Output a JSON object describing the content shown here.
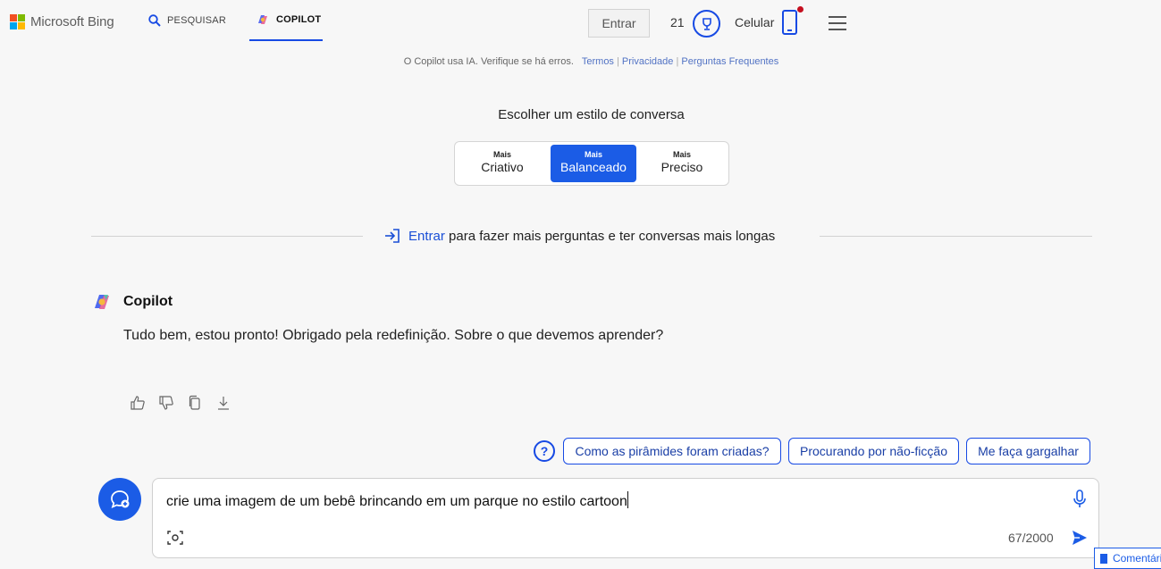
{
  "header": {
    "logo_text": "Microsoft Bing",
    "nav_search": "PESQUISAR",
    "nav_copilot": "COPILOT",
    "signin_button": "Entrar",
    "points": "21",
    "mobile_label": "Celular"
  },
  "disclaimer": {
    "text": "O Copilot usa IA. Verifique se há erros.",
    "terms": "Termos",
    "privacy": "Privacidade",
    "faq": "Perguntas Frequentes"
  },
  "style_picker": {
    "title": "Escolher um estilo de conversa",
    "options": [
      {
        "prefix": "Mais",
        "label": "Criativo"
      },
      {
        "prefix": "Mais",
        "label": "Balanceado"
      },
      {
        "prefix": "Mais",
        "label": "Preciso"
      }
    ],
    "selected": "Balanceado"
  },
  "signin_prompt": {
    "link": "Entrar",
    "text": "para fazer mais perguntas e ter conversas mais longas"
  },
  "message": {
    "author": "Copilot",
    "text": "Tudo bem, estou pronto! Obrigado pela redefinição. Sobre o que devemos aprender?"
  },
  "suggestions": [
    "Como as pirâmides foram criadas?",
    "Procurando por não-ficção",
    "Me faça gargalhar"
  ],
  "composer": {
    "value": "crie uma imagem de um bebê brincando em um parque no estilo cartoon",
    "counter": "67/2000"
  },
  "feedback": {
    "label": "Comentários"
  },
  "colors": {
    "accent": "#174ae4",
    "selected_style": "#1b5ce6",
    "background": "#f7f7f7"
  }
}
